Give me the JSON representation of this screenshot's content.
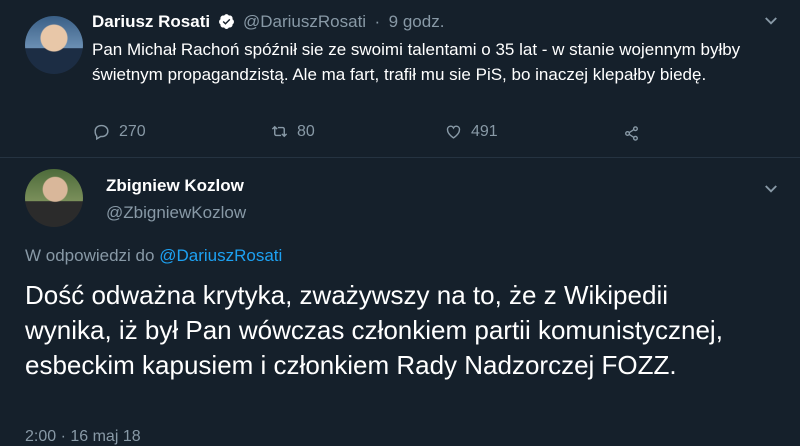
{
  "tweet1": {
    "display_name": "Dariusz Rosati",
    "handle": "@DariuszRosati",
    "separator": "·",
    "time": "9 godz.",
    "text": "Pan Michał Rachoń spóźnił sie ze swoimi talentami o 35 lat - w stanie wojennym byłby świetnym propagandzistą. Ale ma fart, trafił mu sie PiS, bo inaczej klepałby biedę.",
    "replies": "270",
    "retweets": "80",
    "likes": "491"
  },
  "tweet2": {
    "display_name": "Zbigniew Kozlow",
    "handle": "@ZbigniewKozlow",
    "reply_prefix": "W odpowiedzi do",
    "reply_to": "@DariuszRosati",
    "text": "Dość odważna krytyka, zważywszy na to, że z Wikipedii wynika, iż był Pan wówczas członkiem partii komunistycznej, esbeckim kapusiem i członkiem Rady Nadzorczej FOZZ.",
    "timestamp": "2:00 · 16 maj 18"
  },
  "colors": {
    "background": "#15202b",
    "muted": "#8899a6",
    "accent": "#1da1f2"
  }
}
